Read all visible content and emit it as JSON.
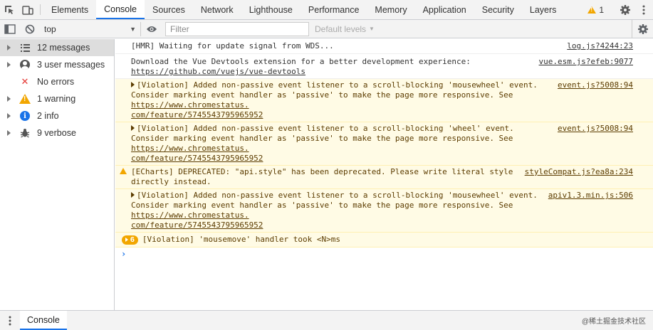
{
  "tabs": [
    {
      "label": "Elements"
    },
    {
      "label": "Console"
    },
    {
      "label": "Sources"
    },
    {
      "label": "Network"
    },
    {
      "label": "Lighthouse"
    },
    {
      "label": "Performance"
    },
    {
      "label": "Memory"
    },
    {
      "label": "Application"
    },
    {
      "label": "Security"
    },
    {
      "label": "Layers"
    }
  ],
  "active_tab": "Console",
  "warning_count": "1",
  "toolbar": {
    "context": "top",
    "filter_placeholder": "Filter",
    "levels": "Default levels"
  },
  "sidebar": {
    "items": [
      {
        "label": "12 messages",
        "icon": "list-icon"
      },
      {
        "label": "3 user messages",
        "icon": "user-icon"
      },
      {
        "label": "No errors",
        "icon": "error-icon"
      },
      {
        "label": "1 warning",
        "icon": "warning-icon"
      },
      {
        "label": "2 info",
        "icon": "info-icon"
      },
      {
        "label": "9 verbose",
        "icon": "bug-icon"
      }
    ]
  },
  "messages": [
    {
      "type": "log",
      "text": "[HMR] Waiting for update signal from WDS...",
      "source": "log.js?4244:23"
    },
    {
      "type": "log",
      "text": "Download the Vue Devtools extension for a better development experience:",
      "link": "https://github.com/vuejs/vue-devtools",
      "source": "vue.esm.js?efeb:9077"
    },
    {
      "type": "violation",
      "line1": "[Violation] Added non-passive event listener to a scroll-blocking 'mousewheel' event.",
      "line2_pre": "Consider marking event handler as 'passive' to make the page more responsive. See ",
      "link_a": "https://www.chromestatus.",
      "link_b": "com/feature/5745543795965952",
      "source": "event.js?5008:94"
    },
    {
      "type": "violation",
      "line1": "[Violation] Added non-passive event listener to a scroll-blocking 'wheel' event.",
      "line2_pre": "Consider marking event handler as 'passive' to make the page more responsive. See ",
      "link_a": "https://www.chromestatus.",
      "link_b": "com/feature/5745543795965952",
      "source": "event.js?5008:94"
    },
    {
      "type": "warning",
      "line1": "[ECharts] DEPRECATED: \"api.style\" has been deprecated. Please write literal style",
      "line2": "directly instead.",
      "source": "styleCompat.js?ea8a:234"
    },
    {
      "type": "violation",
      "line1": "[Violation] Added non-passive event listener to a scroll-blocking 'mousewheel' event.",
      "line2_pre": "Consider marking event handler as 'passive' to make the page more responsive. See ",
      "link_a": "https://www.chromestatus.",
      "link_b": "com/feature/5745543795965952",
      "source": "apiv1.3.min.js:506"
    },
    {
      "type": "grouped",
      "count": "6",
      "text": "[Violation] 'mousemove' handler took <N>ms"
    }
  ],
  "prompt_symbol": "›",
  "drawer": {
    "tab": "Console",
    "watermark": "@稀土掘金技术社区"
  },
  "colors": {
    "accent": "#1a73e8",
    "warning_bg": "#fffbe5",
    "warning_text": "#5c3c00",
    "warning_icon": "#f2a600",
    "error": "#e53935"
  }
}
